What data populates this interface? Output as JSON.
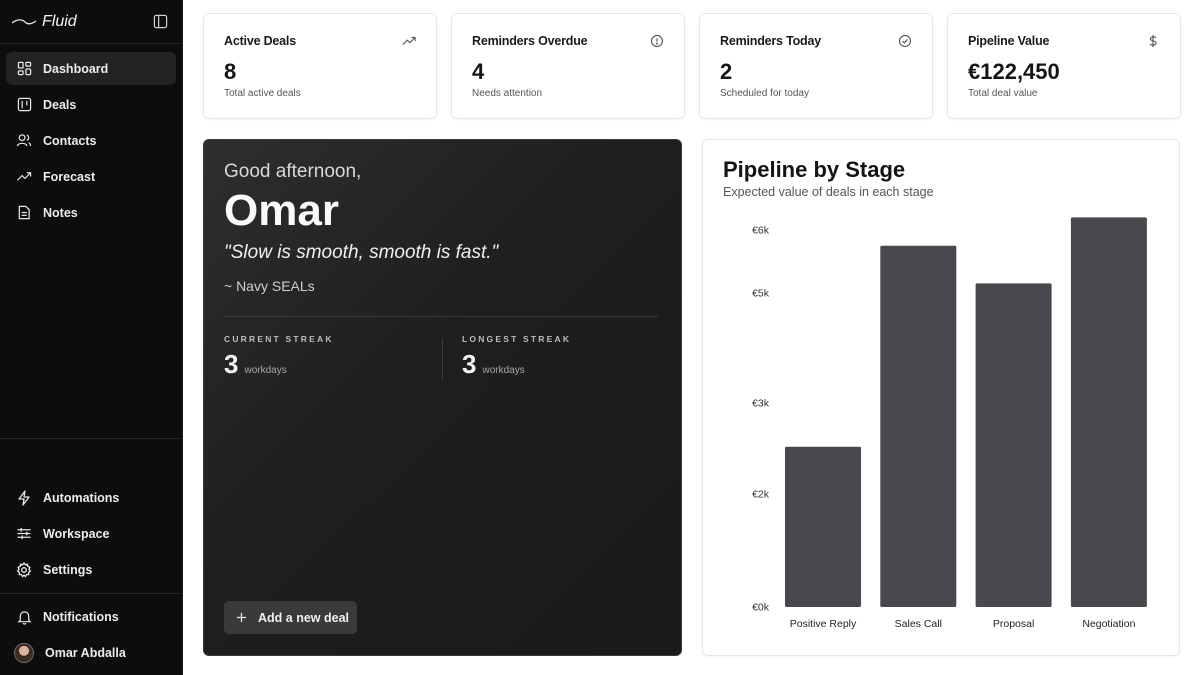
{
  "app": {
    "brand": "Fluid"
  },
  "sidebar": {
    "nav_top": [
      {
        "label": "Dashboard",
        "icon": "dashboard-icon"
      },
      {
        "label": "Deals",
        "icon": "deals-icon"
      },
      {
        "label": "Contacts",
        "icon": "contacts-icon"
      },
      {
        "label": "Forecast",
        "icon": "trend-icon"
      },
      {
        "label": "Notes",
        "icon": "notes-icon"
      }
    ],
    "nav_bottom": [
      {
        "label": "Automations",
        "icon": "bolt-icon"
      },
      {
        "label": "Workspace",
        "icon": "sliders-icon"
      },
      {
        "label": "Settings",
        "icon": "gear-icon"
      }
    ],
    "notifications": "Notifications",
    "user_name": "Omar Abdalla"
  },
  "stats": [
    {
      "title": "Active Deals",
      "value": "8",
      "sub": "Total active deals",
      "icon": "trending-up-icon"
    },
    {
      "title": "Reminders Overdue",
      "value": "4",
      "sub": "Needs attention",
      "icon": "alert-circle-icon"
    },
    {
      "title": "Reminders Today",
      "value": "2",
      "sub": "Scheduled for today",
      "icon": "check-circle-icon"
    },
    {
      "title": "Pipeline Value",
      "value": "€122,450",
      "sub": "Total deal value",
      "icon": "dollar-icon"
    }
  ],
  "greeting": {
    "hello": "Good afternoon,",
    "name": "Omar",
    "quote": "\"Slow is smooth, smooth is fast.\"",
    "author": "~ Navy SEALs",
    "current_label": "CURRENT STREAK",
    "current_value": "3",
    "current_unit": "workdays",
    "longest_label": "LONGEST STREAK",
    "longest_value": "3",
    "longest_unit": "workdays",
    "add_button": "Add a new deal"
  },
  "chart": {
    "title": "Pipeline by Stage",
    "subtitle": "Expected value of deals in each stage"
  },
  "colors": {
    "bar": "#48494d",
    "sidebar_bg": "#0d0d0d"
  },
  "chart_data": {
    "type": "bar",
    "title": "Pipeline by Stage",
    "categories": [
      "Positive Reply",
      "Sales Call",
      "Proposal",
      "Negotiation"
    ],
    "values": [
      2550,
      5750,
      5150,
      6200
    ],
    "yticks": [
      {
        "value": 0,
        "label": "€0k"
      },
      {
        "value": 1800,
        "label": "€2k"
      },
      {
        "value": 3250,
        "label": "€3k"
      },
      {
        "value": 5000,
        "label": "€5k"
      },
      {
        "value": 6000,
        "label": "€6k"
      }
    ],
    "ylim": [
      0,
      6000
    ],
    "grid": false,
    "legend": "none"
  }
}
